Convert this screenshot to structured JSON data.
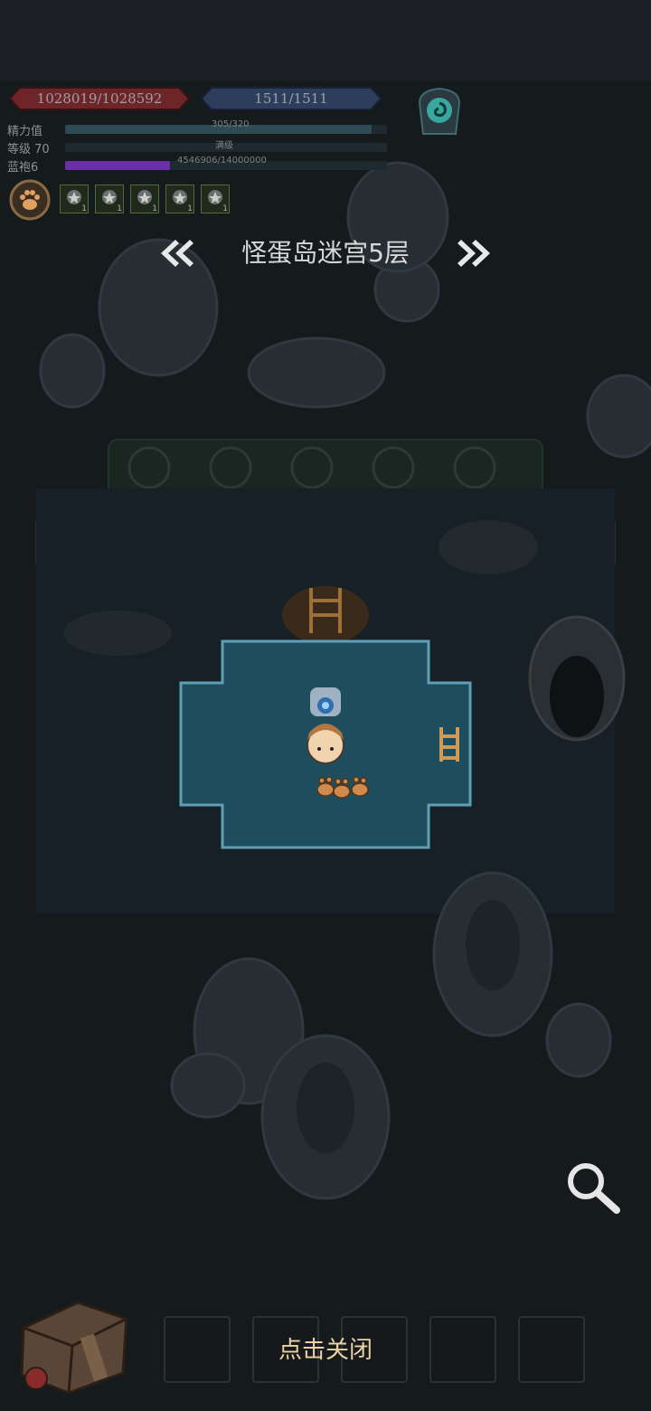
{
  "hud": {
    "hp_text": "1028019/1028592",
    "mp_text": "1511/1511",
    "stats": [
      {
        "label": "精力值",
        "value": "305/320",
        "fill": 0.953,
        "color": "#2e4a55"
      },
      {
        "label": "等级 70",
        "value": "满级",
        "fill": 0.0,
        "color": "#2e4a55"
      },
      {
        "label": "蓝袍6",
        "value": "4546906/14000000",
        "fill": 0.325,
        "color": "#6a2fa8"
      }
    ],
    "rewards": [
      {
        "count": "1"
      },
      {
        "count": "1"
      },
      {
        "count": "1"
      },
      {
        "count": "1"
      },
      {
        "count": "1"
      }
    ]
  },
  "map": {
    "floor_title": "怪蛋岛迷宫5层"
  },
  "bottom": {
    "close_label": "点击关闭"
  },
  "colors": {
    "room_fill": "#1e4d5e",
    "room_border": "#5f9fb5",
    "hp_bar": "#7a2a2d",
    "mp_bar": "#2c3e5c"
  }
}
